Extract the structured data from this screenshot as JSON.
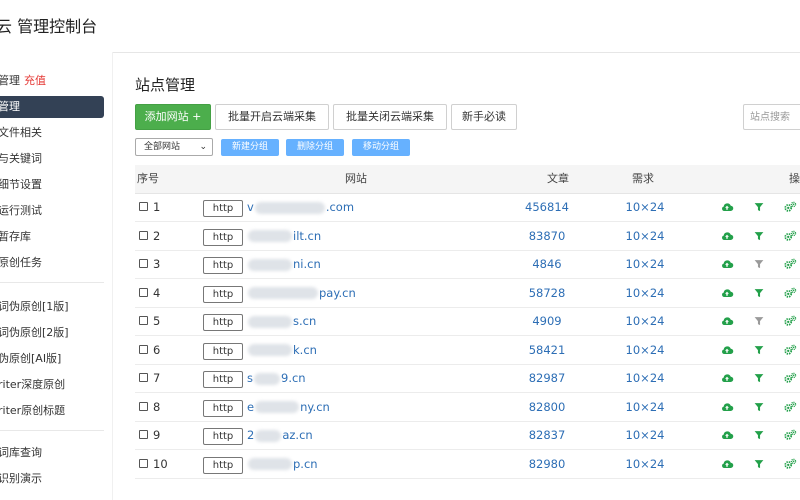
{
  "header": {
    "title": "云 管理控制台"
  },
  "sidebar": {
    "items": [
      {
        "label": "管理",
        "badge": "充值"
      },
      {
        "label": "管理",
        "active": true
      },
      {
        "label": "文件相关"
      },
      {
        "label": "与关键词"
      },
      {
        "label": "细节设置"
      },
      {
        "label": "运行测试"
      },
      {
        "label": "暂存库"
      },
      {
        "label": "原创任务"
      },
      {
        "label": "词伪原创[1版]"
      },
      {
        "label": "词伪原创[2版]"
      },
      {
        "label": "伪原创[AI版]"
      },
      {
        "label": "riter深度原创"
      },
      {
        "label": "riter原创标题"
      },
      {
        "label": "词库查询"
      },
      {
        "label": "识别演示"
      }
    ]
  },
  "main": {
    "title": "站点管理",
    "toolbar": {
      "add_label": "添加网站 +",
      "batch_open_label": "批量开启云端采集",
      "batch_close_label": "批量关闭云端采集",
      "guide_label": "新手必读"
    },
    "search": {
      "placeholder": "站点搜索"
    },
    "group_select": {
      "value": "全部网站"
    },
    "group_buttons": {
      "new": "新建分组",
      "delete": "删除分组",
      "move": "移动分组"
    },
    "table": {
      "headers": [
        "序号",
        "网站",
        "文章",
        "需求",
        "操"
      ],
      "rows": [
        {
          "num": "1",
          "protocol": "http",
          "site_prefix": "v",
          "site_suffix": ".com",
          "articles": "456814",
          "demand": "10×24",
          "filter_active": true
        },
        {
          "num": "2",
          "protocol": "http",
          "site_prefix": "",
          "site_suffix": "ilt.cn",
          "articles": "83870",
          "demand": "10×24",
          "filter_active": true
        },
        {
          "num": "3",
          "protocol": "http",
          "site_prefix": "",
          "site_suffix": "ni.cn",
          "articles": "4846",
          "demand": "10×24",
          "filter_active": false
        },
        {
          "num": "4",
          "protocol": "http",
          "site_prefix": "",
          "site_suffix": "pay.cn",
          "articles": "58728",
          "demand": "10×24",
          "filter_active": true
        },
        {
          "num": "5",
          "protocol": "http",
          "site_prefix": "",
          "site_suffix": "s.cn",
          "articles": "4909",
          "demand": "10×24",
          "filter_active": false
        },
        {
          "num": "6",
          "protocol": "http",
          "site_prefix": "",
          "site_suffix": "k.cn",
          "articles": "58421",
          "demand": "10×24",
          "filter_active": true
        },
        {
          "num": "7",
          "protocol": "http",
          "site_prefix": "s",
          "site_suffix": "9.cn",
          "articles": "82987",
          "demand": "10×24",
          "filter_active": true
        },
        {
          "num": "8",
          "protocol": "http",
          "site_prefix": "e",
          "site_suffix": "ny.cn",
          "articles": "82800",
          "demand": "10×24",
          "filter_active": true
        },
        {
          "num": "9",
          "protocol": "http",
          "site_prefix": "2",
          "site_suffix": "az.cn",
          "articles": "82837",
          "demand": "10×24",
          "filter_active": true
        },
        {
          "num": "10",
          "protocol": "http",
          "site_prefix": "",
          "site_suffix": "p.cn",
          "articles": "82980",
          "demand": "10×24",
          "filter_active": true
        }
      ]
    }
  },
  "colors": {
    "accent_green": "#4cae4c",
    "link_blue": "#2d6eb5",
    "sidebar_active": "#334155",
    "recharge_red": "#e53935",
    "icon_green": "#23a04a",
    "icon_gray": "#9a9a9a"
  },
  "icons": {
    "upload": "cloud-upload-icon",
    "filter": "filter-icon",
    "settings": "gears-icon"
  }
}
